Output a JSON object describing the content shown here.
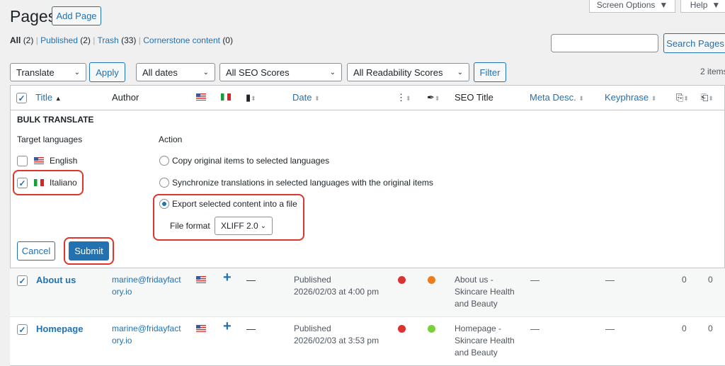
{
  "header": {
    "title": "Pages",
    "add_page": "Add Page",
    "screen_options": "Screen Options",
    "help": "Help"
  },
  "views": [
    {
      "label": "All",
      "count": "(2)"
    },
    {
      "label": "Published",
      "count": "(2)"
    },
    {
      "label": "Trash",
      "count": "(33)"
    },
    {
      "label": "Cornerstone content",
      "count": "(0)"
    }
  ],
  "search": {
    "value": "",
    "button": "Search Pages"
  },
  "filters": {
    "bulk_action": "Translate",
    "apply": "Apply",
    "dates": "All dates",
    "seo": "All SEO Scores",
    "readability": "All Readability Scores",
    "filter": "Filter",
    "items": "2 items"
  },
  "columns": {
    "title": "Title",
    "author": "Author",
    "date": "Date",
    "seo_title": "SEO Title",
    "meta": "Meta Desc.",
    "keyphrase": "Keyphrase"
  },
  "bulk": {
    "heading": "BULK TRANSLATE",
    "target_label": "Target languages",
    "action_label": "Action",
    "languages": [
      {
        "name": "English",
        "checked": false
      },
      {
        "name": "Italiano",
        "checked": true
      }
    ],
    "actions": [
      "Copy original items to selected languages",
      "Synchronize translations in selected languages with the original items",
      "Export selected content into a file"
    ],
    "file_format_label": "File format",
    "file_format": "XLIFF 2.0",
    "cancel": "Cancel",
    "submit": "Submit"
  },
  "rows": [
    {
      "title": "About us",
      "author1": "marine@fridayfact",
      "author2": "ory.io",
      "dash": "—",
      "status": "Published",
      "date": "2026/02/03 at 4:00 pm",
      "seo_color": "#dc3232",
      "read_color": "#ee7c1b",
      "seo_title": [
        "About us -",
        "Skincare Health",
        "and Beauty"
      ],
      "meta": "—",
      "keyphrase": "—",
      "links_in": "0",
      "links_out": "0"
    },
    {
      "title": "Homepage",
      "author1": "marine@fridayfact",
      "author2": "ory.io",
      "dash": "—",
      "status": "Published",
      "date": "2026/02/03 at 3:53 pm",
      "seo_color": "#dc3232",
      "read_color": "#7ad03a",
      "seo_title": [
        "Homepage -",
        "Skincare Health",
        "and Beauty"
      ],
      "meta": "—",
      "keyphrase": "—",
      "links_in": "0",
      "links_out": "0"
    }
  ]
}
